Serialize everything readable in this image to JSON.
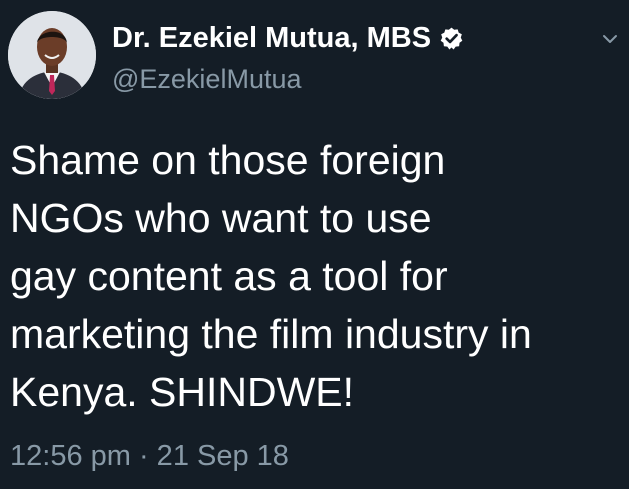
{
  "tweet": {
    "display_name": "Dr. Ezekiel Mutua, MBS",
    "handle": "@EzekielMutua",
    "verified": true,
    "text": "Shame on those foreign\nNGOs who want to use\ngay content as a tool for\nmarketing the film industry in\nKenya. SHINDWE!",
    "timestamp": "12:56 pm · 21 Sep 18"
  },
  "icons": {
    "verified": "verified-badge-icon",
    "menu": "chevron-down-icon"
  },
  "colors": {
    "background": "#141d26",
    "primary_text": "#ffffff",
    "secondary_text": "#8899a6"
  }
}
